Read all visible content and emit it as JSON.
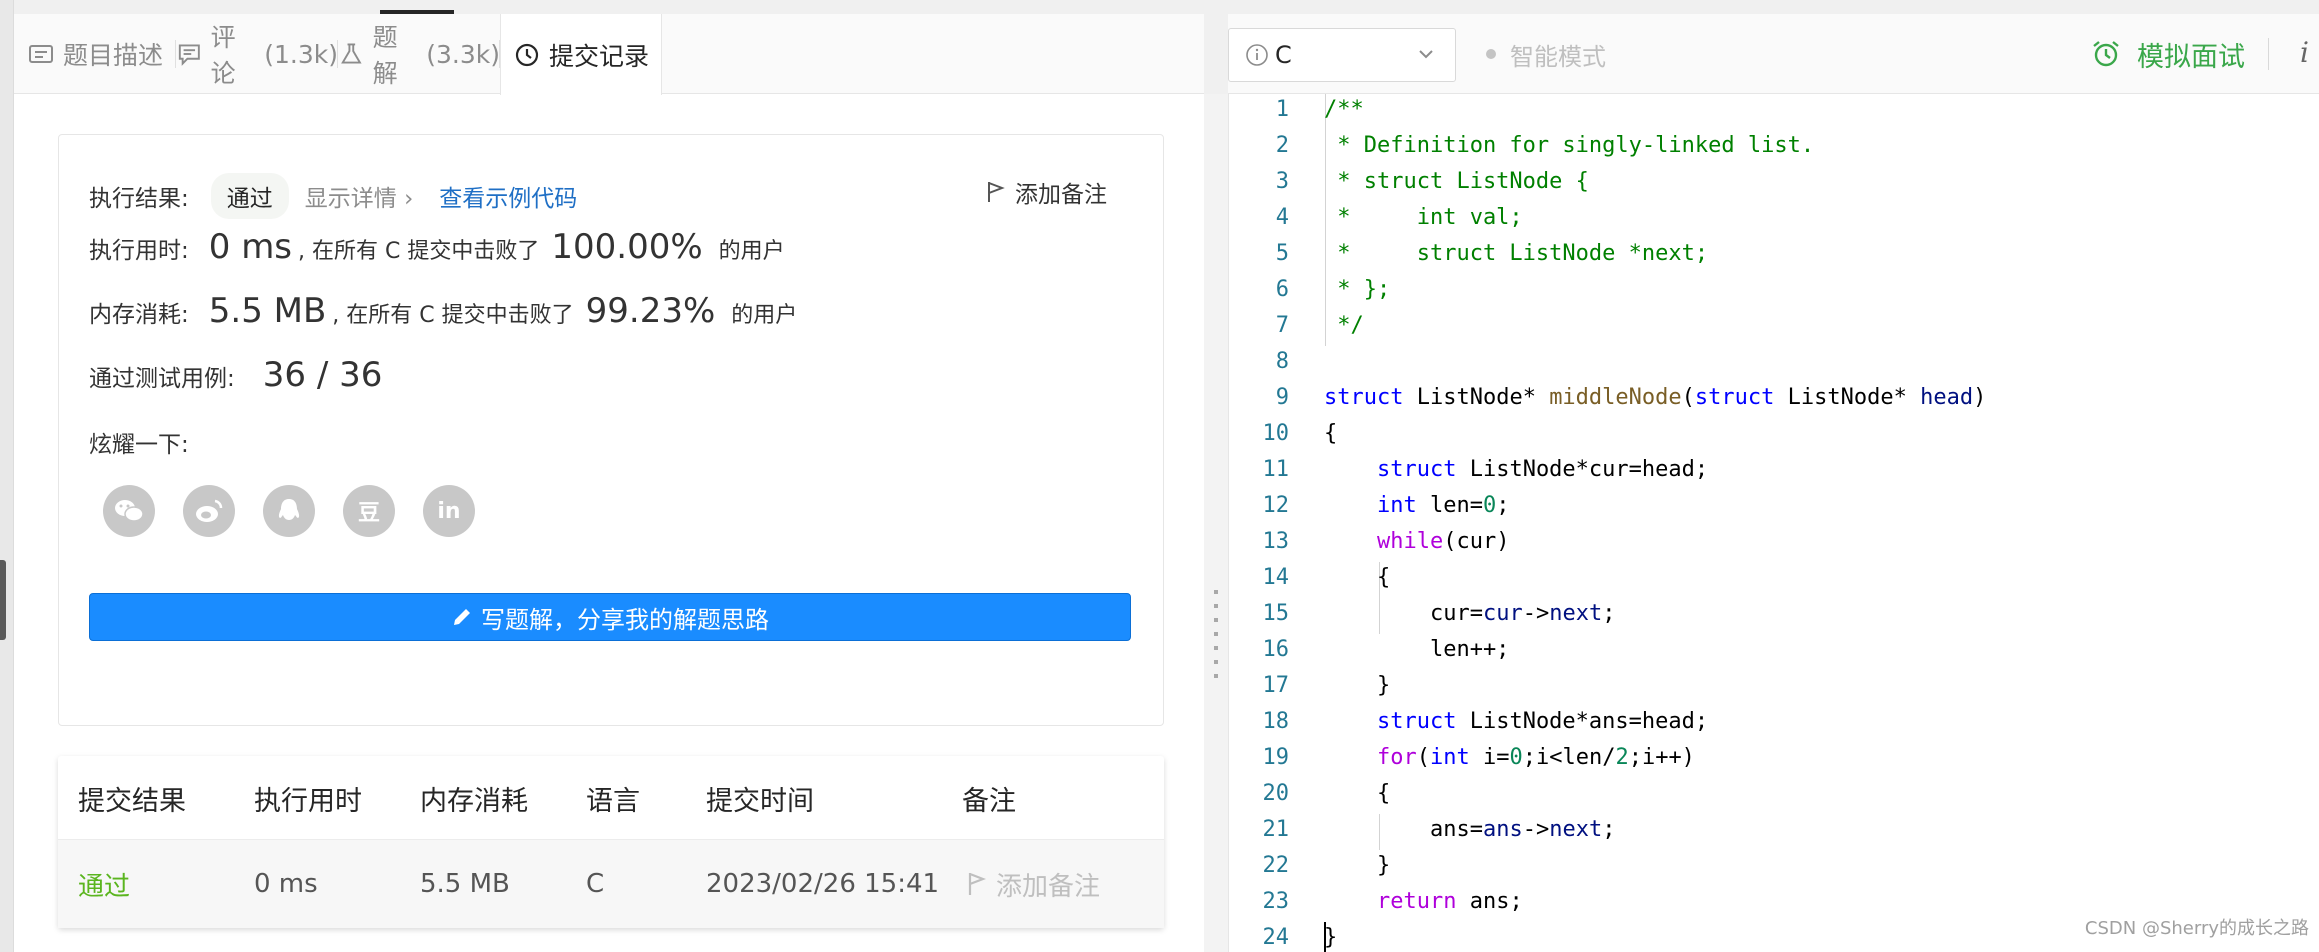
{
  "tabs": [
    {
      "label": "题目描述",
      "count": "",
      "icon": "description-icon"
    },
    {
      "label": "评论",
      "count": "(1.3k)",
      "icon": "comment-icon"
    },
    {
      "label": "题解",
      "count": "(3.3k)",
      "icon": "flask-icon"
    },
    {
      "label": "提交记录",
      "count": "",
      "icon": "clock-icon",
      "active": true
    }
  ],
  "result": {
    "label": "执行结果:",
    "status": "通过",
    "details": "显示详情",
    "details_chevron": "›",
    "sample_link": "查看示例代码",
    "add_note": "添加备注",
    "time_label": "执行用时:",
    "time_value": "0 ms",
    "time_mid": ", 在所有 C 提交中击败了",
    "time_pct": "100.00%",
    "time_tail": "的用户",
    "mem_label": "内存消耗:",
    "mem_value": "5.5 MB",
    "mem_mid": ", 在所有 C 提交中击败了",
    "mem_pct": "99.23%",
    "mem_tail": "的用户",
    "tests_label": "通过测试用例:",
    "tests_value": "36 / 36",
    "share_label": "炫耀一下:",
    "share_icons": [
      "wechat-icon",
      "weibo-icon",
      "qq-icon",
      "douban-icon",
      "linkedin-icon"
    ],
    "douban_glyph": "豆",
    "linkedin_glyph": "in",
    "write_button": "写题解，分享我的解题思路"
  },
  "table": {
    "headers": [
      "提交结果",
      "执行用时",
      "内存消耗",
      "语言",
      "提交时间",
      "备注"
    ],
    "rows": [
      {
        "result": "通过",
        "time": "0 ms",
        "memory": "5.5 MB",
        "lang": "C",
        "submitted": "2023/02/26 15:41",
        "note": "添加备注"
      }
    ]
  },
  "editor_header": {
    "language": "C",
    "smart_mode": "智能模式",
    "mock_interview": "模拟面试",
    "info": "i"
  },
  "code": {
    "line_numbers": [
      "1",
      "2",
      "3",
      "4",
      "5",
      "6",
      "7",
      "8",
      "9",
      "10",
      "11",
      "12",
      "13",
      "14",
      "15",
      "16",
      "17",
      "18",
      "19",
      "20",
      "21",
      "22",
      "23",
      "24"
    ],
    "lines": [
      [
        [
          "comment",
          "/**"
        ]
      ],
      [
        [
          "comment",
          " * Definition for singly-linked list."
        ]
      ],
      [
        [
          "comment",
          " * struct ListNode {"
        ]
      ],
      [
        [
          "comment",
          " *     int val;"
        ]
      ],
      [
        [
          "comment",
          " *     struct ListNode *next;"
        ]
      ],
      [
        [
          "comment",
          " * };"
        ]
      ],
      [
        [
          "comment",
          " */"
        ]
      ],
      [],
      [
        [
          "kw",
          "struct"
        ],
        [
          "op",
          " ListNode* "
        ],
        [
          "fn",
          "middleNode"
        ],
        [
          "op",
          "("
        ],
        [
          "kw",
          "struct"
        ],
        [
          "op",
          " ListNode* "
        ],
        [
          "var",
          "head"
        ],
        [
          "op",
          ")"
        ]
      ],
      [
        [
          "op",
          "{"
        ]
      ],
      [
        [
          "op",
          "    "
        ],
        [
          "kw",
          "struct"
        ],
        [
          "op",
          " ListNode*cur=head;"
        ]
      ],
      [
        [
          "op",
          "    "
        ],
        [
          "kw",
          "int"
        ],
        [
          "op",
          " len="
        ],
        [
          "num",
          "0"
        ],
        [
          "op",
          ";"
        ]
      ],
      [
        [
          "op",
          "    "
        ],
        [
          "ctl",
          "while"
        ],
        [
          "op",
          "(cur)"
        ]
      ],
      [
        [
          "op",
          "    {"
        ]
      ],
      [
        [
          "op",
          "        cur="
        ],
        [
          "var",
          "cur"
        ],
        [
          "op",
          "->"
        ],
        [
          "var",
          "next"
        ],
        [
          "op",
          ";"
        ]
      ],
      [
        [
          "op",
          "        len++;"
        ]
      ],
      [
        [
          "op",
          "    }"
        ]
      ],
      [
        [
          "op",
          "    "
        ],
        [
          "kw",
          "struct"
        ],
        [
          "op",
          " ListNode*ans=head;"
        ]
      ],
      [
        [
          "op",
          "    "
        ],
        [
          "ctl",
          "for"
        ],
        [
          "op",
          "("
        ],
        [
          "kw",
          "int"
        ],
        [
          "op",
          " i="
        ],
        [
          "num",
          "0"
        ],
        [
          "op",
          ";i<len/"
        ],
        [
          "num",
          "2"
        ],
        [
          "op",
          ";i++)"
        ]
      ],
      [
        [
          "op",
          "    {"
        ]
      ],
      [
        [
          "op",
          "        ans="
        ],
        [
          "var",
          "ans"
        ],
        [
          "op",
          "->"
        ],
        [
          "var",
          "next"
        ],
        [
          "op",
          ";"
        ]
      ],
      [
        [
          "op",
          "    }"
        ]
      ],
      [
        [
          "op",
          "    "
        ],
        [
          "ctl",
          "return"
        ],
        [
          "op",
          " ans;"
        ]
      ],
      [
        [
          "op",
          "}"
        ]
      ]
    ]
  },
  "watermark": "CSDN @Sherry的成长之路",
  "colors": {
    "accent": "#1a8cff",
    "success": "#5bb51f",
    "mock": "#3aa74a"
  }
}
